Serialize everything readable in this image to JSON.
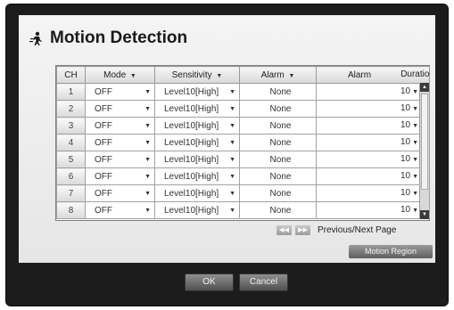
{
  "dialog": {
    "title": "Motion Detection"
  },
  "table": {
    "headers": {
      "ch": "CH",
      "mode": "Mode",
      "sensitivity": "Sensitivity",
      "alarm1": "Alarm",
      "alarm2": "Alarm",
      "duration": "Duration"
    },
    "rows": [
      {
        "ch": "1",
        "mode": "OFF",
        "sensitivity": "Level10[High]",
        "alarm": "None",
        "duration": "10"
      },
      {
        "ch": "2",
        "mode": "OFF",
        "sensitivity": "Level10[High]",
        "alarm": "None",
        "duration": "10"
      },
      {
        "ch": "3",
        "mode": "OFF",
        "sensitivity": "Level10[High]",
        "alarm": "None",
        "duration": "10"
      },
      {
        "ch": "4",
        "mode": "OFF",
        "sensitivity": "Level10[High]",
        "alarm": "None",
        "duration": "10"
      },
      {
        "ch": "5",
        "mode": "OFF",
        "sensitivity": "Level10[High]",
        "alarm": "None",
        "duration": "10"
      },
      {
        "ch": "6",
        "mode": "OFF",
        "sensitivity": "Level10[High]",
        "alarm": "None",
        "duration": "10"
      },
      {
        "ch": "7",
        "mode": "OFF",
        "sensitivity": "Level10[High]",
        "alarm": "None",
        "duration": "10"
      },
      {
        "ch": "8",
        "mode": "OFF",
        "sensitivity": "Level10[High]",
        "alarm": "None",
        "duration": "10"
      }
    ]
  },
  "pager": {
    "label": "Previous/Next Page"
  },
  "buttons": {
    "motion_region": "Motion Region",
    "ok": "OK",
    "cancel": "Cancel"
  }
}
